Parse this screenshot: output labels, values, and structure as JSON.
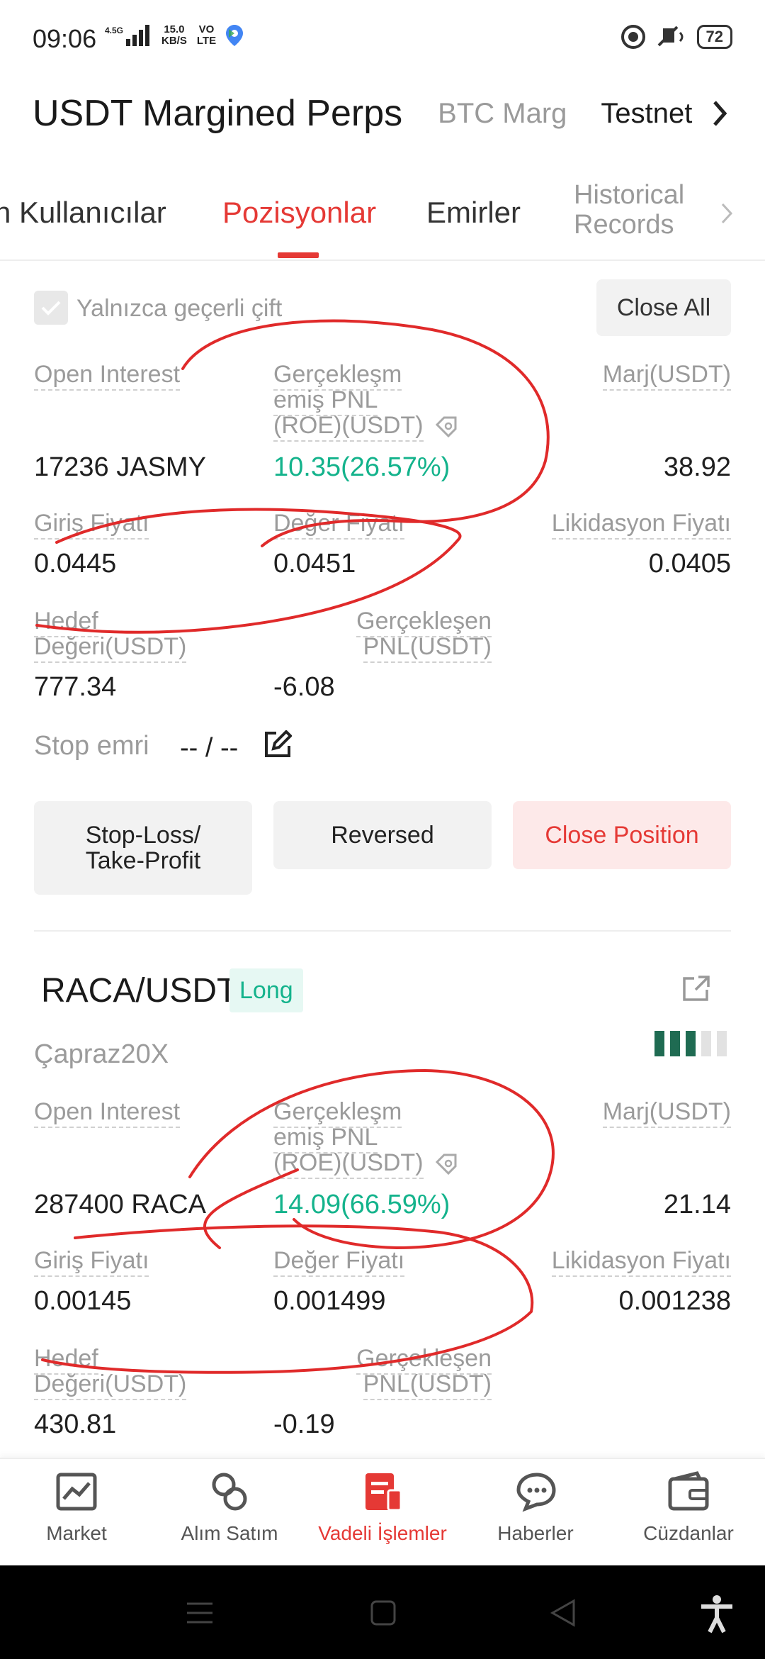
{
  "status": {
    "time": "09:06",
    "net_type": "4.5G",
    "speed_value": "15.0",
    "speed_unit": "KB/S",
    "volte_top": "VO",
    "volte_bottom": "LTE",
    "battery": "72"
  },
  "header": {
    "title": "USDT Margined Perps",
    "tabs": [
      "BTC Marg",
      "Testnet"
    ]
  },
  "tabs": {
    "items": [
      "n Kullanıcılar",
      "Pozisyonlar",
      "Emirler"
    ],
    "historical_line1": "Historical",
    "historical_line2": "Records",
    "active": "Pozisyonlar"
  },
  "filter": {
    "checkbox_label": "Yalnızca geçerli çift",
    "checked": true,
    "close_all": "Close All"
  },
  "labels": {
    "open_interest": "Open Interest",
    "realized_pnl_1": "Gerçekleşm",
    "realized_pnl_2": "emiş PNL",
    "realized_pnl_3": "(ROE)(USDT)",
    "margin": "Marj(USDT)",
    "entry_price": "Giriş Fiyatı",
    "mark_price": "Değer Fiyatı",
    "liq_price": "Likidasyon Fiyatı",
    "target_value_1": "Hedef",
    "target_value_2": "Değeri(USDT)",
    "realized_1": "Gerçekleşen",
    "realized_2": "PNL(USDT)"
  },
  "position1": {
    "open_interest": "17236 JASMY",
    "pnl_roe": "10.35(26.57%)",
    "margin": "38.92",
    "entry_price": "0.0445",
    "mark_price": "0.0451",
    "liq_price": "0.0405",
    "target_value": "777.34",
    "realized_pnl": "-6.08",
    "stop_label": "Stop emri",
    "stop_value": "-- / --",
    "btn_sltp_1": "Stop-Loss/",
    "btn_sltp_2": "Take-Profit",
    "btn_reversed": "Reversed",
    "btn_close": "Close Position"
  },
  "position2": {
    "pair": "RACA/USDT",
    "side": "Long",
    "leverage": "Çapraz20X",
    "risk_level": 3,
    "risk_total": 5,
    "open_interest": "287400 RACA",
    "pnl_roe": "14.09(66.59%)",
    "margin": "21.14",
    "entry_price": "0.00145",
    "mark_price": "0.001499",
    "liq_price": "0.001238",
    "target_value": "430.81",
    "realized_pnl": "-0.19"
  },
  "nav": {
    "items": [
      "Market",
      "Alım Satım",
      "Vadeli İşlemler",
      "Haberler",
      "Cüzdanlar"
    ],
    "active": "Vadeli İşlemler"
  },
  "colors": {
    "accent": "#e53935",
    "profit": "#14b38c",
    "muted": "#9b9b9b",
    "annotation": "#e02a2a"
  }
}
